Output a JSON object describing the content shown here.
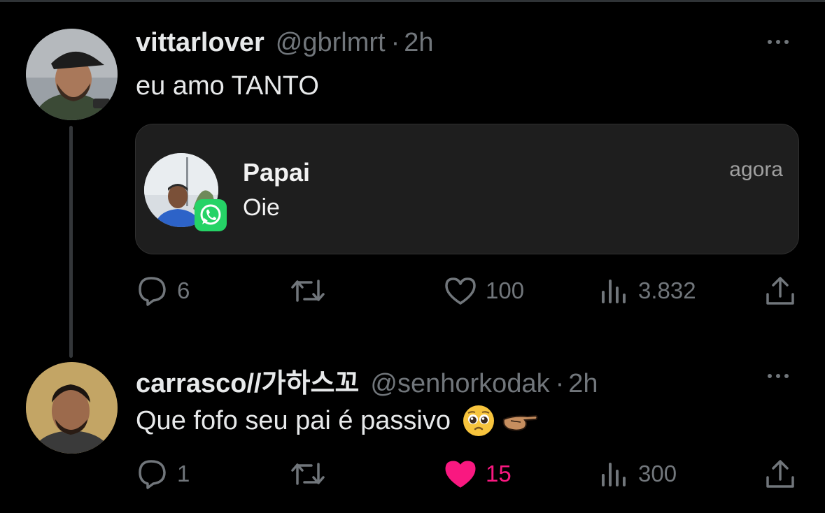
{
  "tweets": [
    {
      "name": "vittarlover",
      "handle": "@gbrlmrt",
      "separator": "·",
      "time": "2h",
      "text": "eu amo TANTO",
      "notification": {
        "title": "Papai",
        "body": "Oie",
        "time": "agora",
        "badge_icon": "whatsapp-icon"
      },
      "stats": {
        "replies": "6",
        "retweets": "",
        "likes": "100",
        "views": "3.832"
      },
      "liked": false
    },
    {
      "name": "carrasco//가하스꼬",
      "handle": "@senhorkodak",
      "separator": "·",
      "time": "2h",
      "text": "Que fofo seu pai é passivo",
      "emojis": [
        "pleading-face-emoji",
        "pointing-hand-emoji"
      ],
      "stats": {
        "replies": "1",
        "retweets": "",
        "likes": "15",
        "views": "300"
      },
      "liked": true
    }
  ],
  "colors": {
    "background": "#000000",
    "text": "#e7e9ea",
    "secondary": "#71767b",
    "like_active": "#f91880",
    "thread_line": "#333639",
    "whatsapp_green": "#25d366"
  }
}
